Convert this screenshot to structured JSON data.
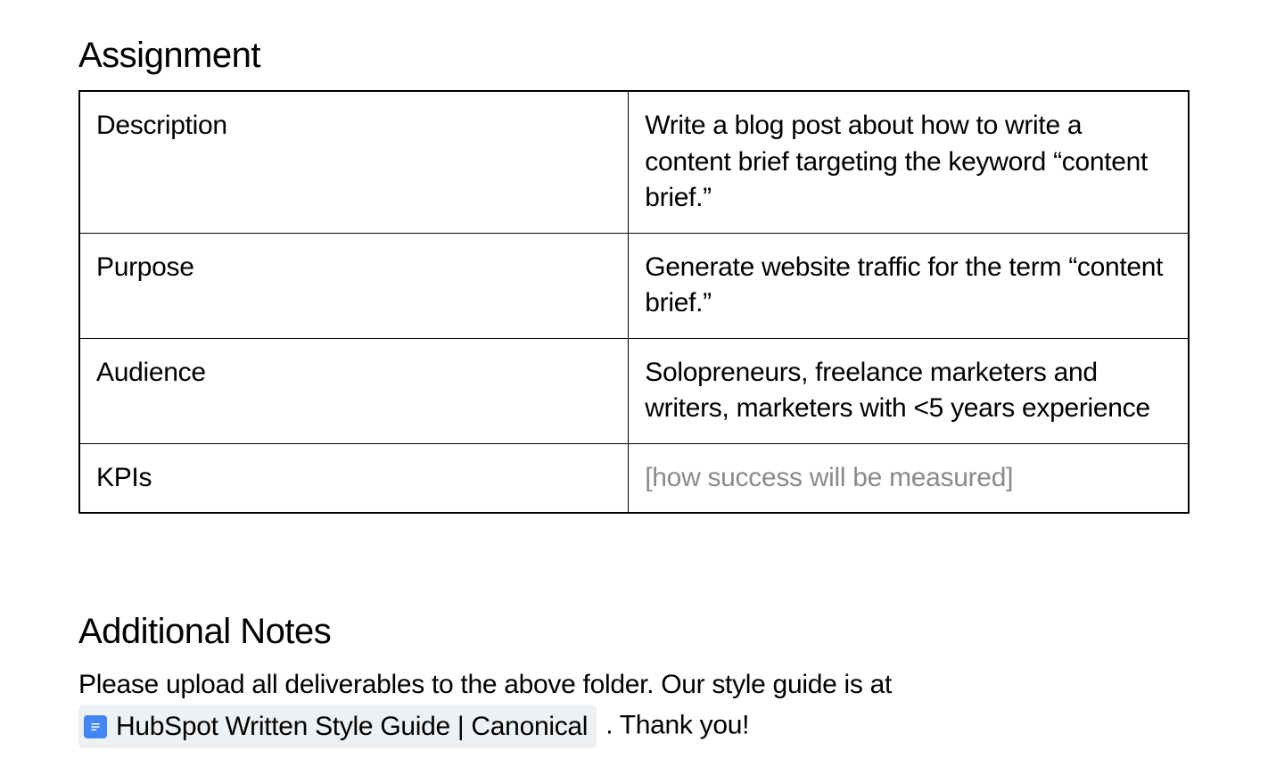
{
  "assignment": {
    "heading": "Assignment",
    "rows": [
      {
        "label": "Description",
        "value": "Write a blog post about how to write a content brief targeting the keyword “content brief.”",
        "placeholder": false
      },
      {
        "label": "Purpose",
        "value": "Generate website traffic for the term “content brief.”",
        "placeholder": false
      },
      {
        "label": "Audience",
        "value": "Solopreneurs, freelance marketers and writers, marketers with <5 years experience",
        "placeholder": false
      },
      {
        "label": "KPIs",
        "value": "[how success will be measured]",
        "placeholder": true
      }
    ]
  },
  "notes": {
    "heading": "Additional Notes",
    "pre_text": "Please upload all deliverables to the above folder. Our style guide is at ",
    "doc_link_label": "HubSpot Written Style Guide | Canonical",
    "post_text": " . Thank you!"
  }
}
